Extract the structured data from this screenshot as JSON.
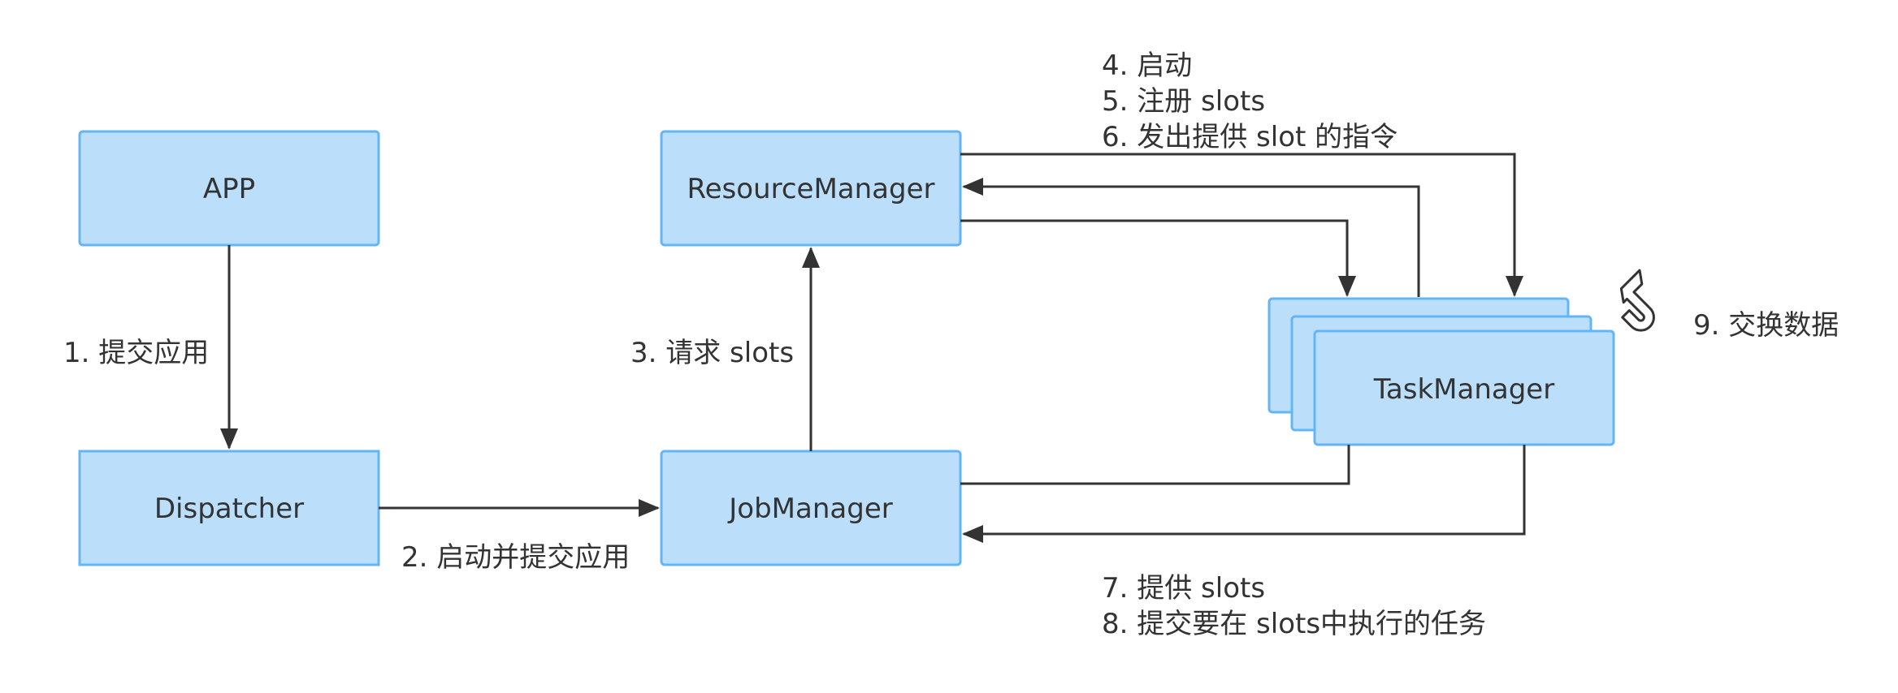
{
  "nodes": {
    "app": "APP",
    "dispatcher": "Dispatcher",
    "resource_manager": "ResourceManager",
    "job_manager": "JobManager",
    "task_manager": "TaskManager"
  },
  "edges": {
    "submit_app": "1. 提交应用",
    "start_submit": "2. 启动并提交应用",
    "request_slots": "3. 请求 slots",
    "rm_tm_lines": [
      "4. 启动",
      "5. 注册 slots",
      "6. 发出提供 slot 的指令"
    ],
    "tm_jm_lines": [
      "7. 提供 slots",
      "8. 提交要在 slots中执行的任务"
    ],
    "exchange_data": "9. 交换数据"
  },
  "colors": {
    "node_fill": "#bbdefb",
    "node_border": "#64b5f6",
    "edge": "#333333",
    "text": "#333333"
  }
}
